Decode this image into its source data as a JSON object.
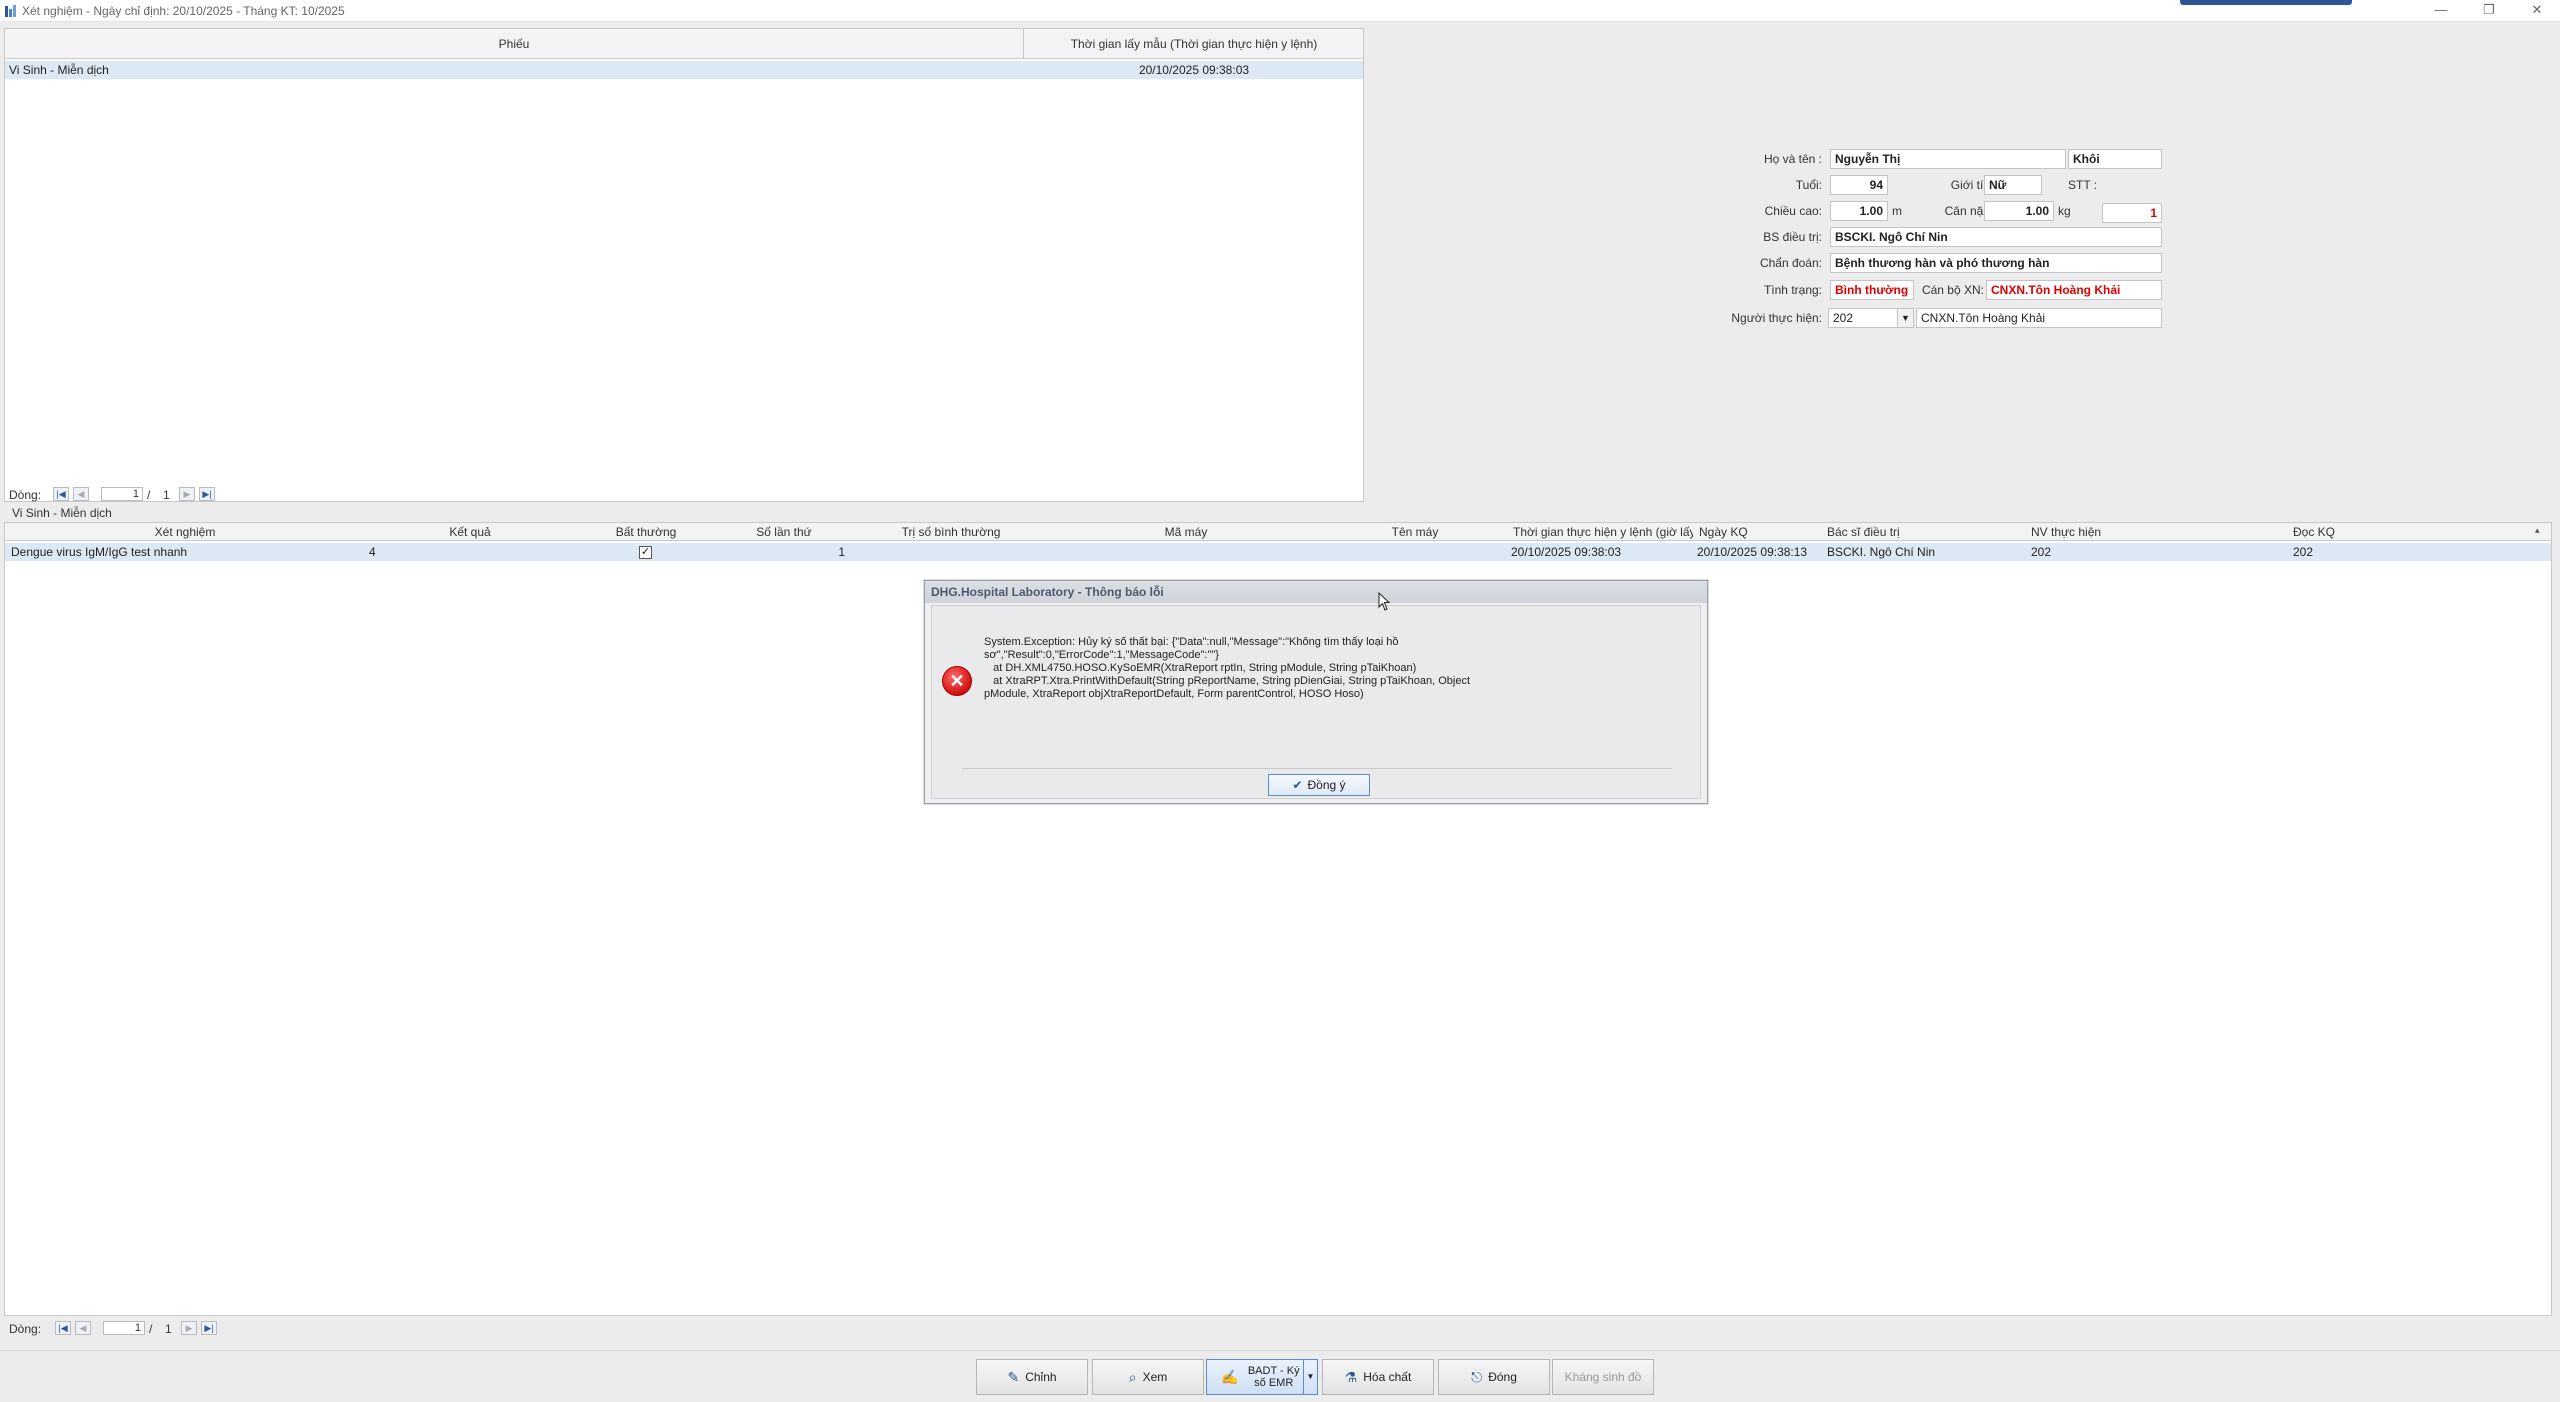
{
  "window": {
    "title": "Xét nghiệm - Ngày chỉ định: 20/10/2025 - Tháng KT: 10/2025",
    "minimize": "—",
    "restore": "❐",
    "close": "✕"
  },
  "top_grid": {
    "columns": [
      "Phiếu",
      "Thời gian lấy mẫu (Thời gian thực hiện y lệnh)"
    ],
    "rows": [
      [
        "Vi Sinh - Miễn dịch",
        "20/10/2025 09:38:03"
      ]
    ],
    "nav": {
      "label": "Dòng:",
      "current": "1",
      "sep": "/",
      "total": "1"
    }
  },
  "patient": {
    "name_label": "Họ và tên :",
    "name_first": "Nguyễn Thị",
    "name_last": "Khôi",
    "age_label": "Tuổi:",
    "age": "94",
    "gender_label": "Giới tính:",
    "gender": "Nữ",
    "stt_label": "STT :",
    "height_label": "Chiều cao:",
    "height": "1.00",
    "height_unit": "m",
    "weight_label": "Cân nặng:",
    "weight": "1.00",
    "weight_unit": "kg",
    "stt_value": "1",
    "doctor_label": "BS điều trị:",
    "doctor": "BSCKI. Ngô Chí Nin",
    "diagnosis_label": "Chẩn đoán:",
    "diagnosis": "Bệnh thương hàn và phó thương hàn",
    "status_label": "Tình trạng:",
    "status": "Bình thường",
    "staff_label": "Cán bộ XN:",
    "staff": "CNXN.Tôn Hoàng Khải",
    "performer_label": "Người thực hiện:",
    "performer_code": "202",
    "performer_name": "CNXN.Tôn Hoàng Khải"
  },
  "section_label": "Vi Sinh - Miễn dịch",
  "bottom_grid": {
    "columns": [
      "Xét nghiệm",
      "Kết quả",
      "Bất thường",
      "Số lần thứ",
      "Trị số bình thường",
      "Mã máy",
      "Tên máy",
      "Thời gian thực hiện y lệnh (giờ lấy ...",
      "Ngày KQ",
      "Bác sĩ điều trị",
      "NV thực hiện",
      "Đọc KQ"
    ],
    "row": {
      "test": "Dengue virus IgM/IgG test nhanh",
      "result": "4",
      "count": "1",
      "order_time": "20/10/2025 09:38:03",
      "result_date": "20/10/2025 09:38:13",
      "doctor": "BSCKI. Ngô Chí Nin",
      "staff": "202",
      "reader": "202"
    },
    "nav": {
      "label": "Dòng:",
      "current": "1",
      "sep": "/",
      "total": "1"
    }
  },
  "dialog": {
    "title": "DHG.Hospital Laboratory - Thông báo lỗi",
    "message": "System.Exception: Hủy ký số thất bại: {\"Data\":null,\"Message\":\"Không tìm thấy loại hồ\nsơ\",\"Result\":0,\"ErrorCode\":1,\"MessageCode\":\"\"}\n   at DH.XML4750.HOSO.KySoEMR(XtraReport rptIn, String pModule, String pTaiKhoan)\n   at XtraRPT.Xtra.PrintWithDefault(String pReportName, String pDienGiai, String pTaiKhoan, Object\npModule, XtraReport objXtraReportDefault, Form parentControl, HOSO Hoso)",
    "ok_label": "Đồng ý"
  },
  "toolbar": {
    "edit": "Chỉnh",
    "view": "Xem",
    "sign": "BADT - Ký số EMR",
    "chemicals": "Hóa chất",
    "close": "Đóng",
    "birth_cert": "Kháng sinh đồ"
  }
}
